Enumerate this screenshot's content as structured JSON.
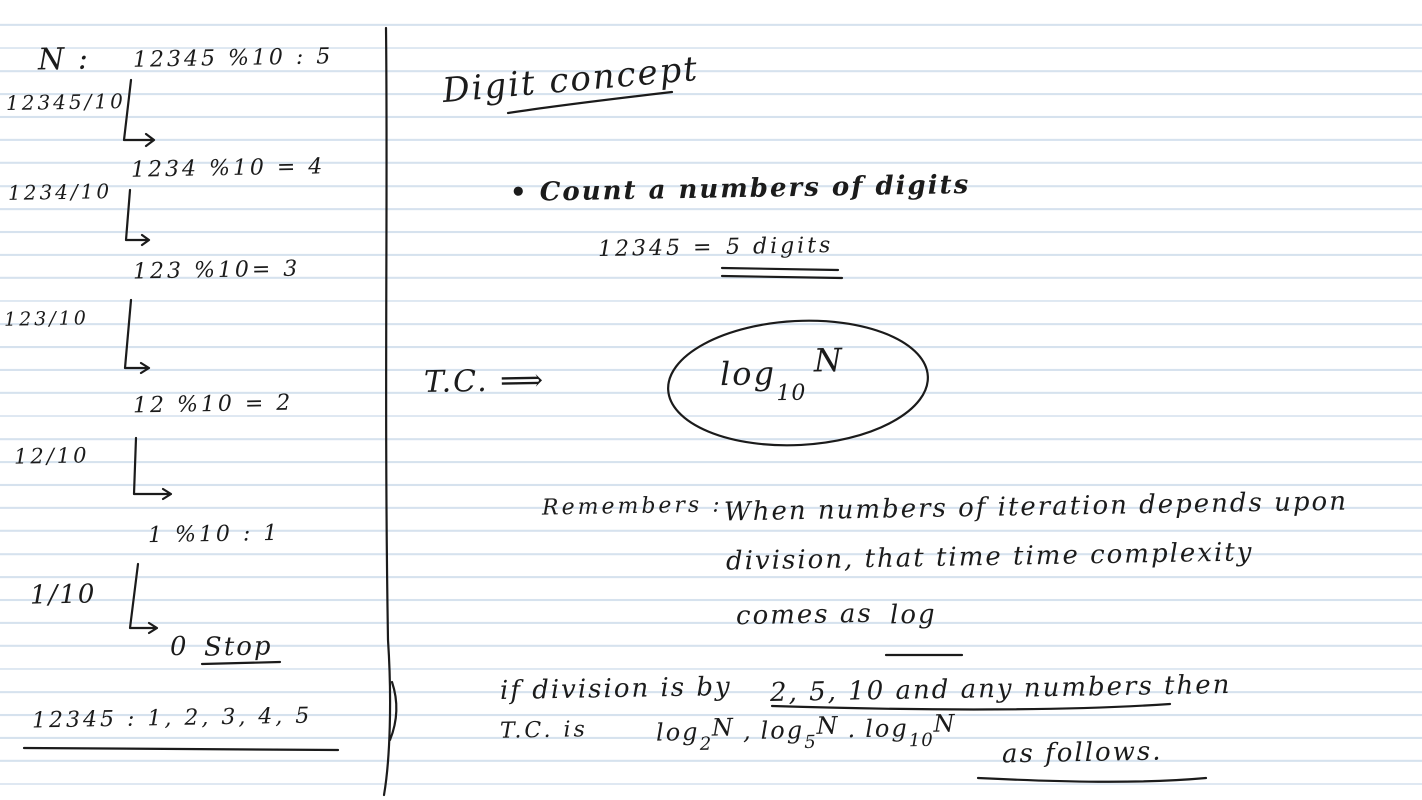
{
  "left_column": {
    "n_label": "N :",
    "steps": [
      {
        "division": "12345/10",
        "modulo": "12345 %10 : 5"
      },
      {
        "division": "1234/10",
        "modulo": "1234 %10 = 4"
      },
      {
        "division": "123/10",
        "modulo": "123 %10= 3"
      },
      {
        "division": "12/10",
        "modulo": "12 %10 = 2"
      },
      {
        "division": "1/10",
        "modulo": "1 %10 : 1"
      }
    ],
    "final_zero": "0",
    "stop_label": "Stop",
    "result": "12345 : 1, 2, 3, 4, 5"
  },
  "right_column": {
    "title": "Digit concept",
    "bullet": "• Count a numbers of digits",
    "example": "12345 =",
    "example_result": "5 digits",
    "tc_label": "T.C. ⟹",
    "tc_log": "log",
    "tc_base": "10",
    "tc_var": "N",
    "remember_label": "Remembers :",
    "remember_lines": [
      "When numbers of iteration depends upon",
      "division, that time time complexity",
      "comes as"
    ],
    "remember_log": "log",
    "note_line1_a": "if division is by",
    "note_line1_b": "2, 5, 10 and any numbers then",
    "note_line2_a": "T.C. is",
    "note_logs": [
      {
        "log": "log",
        "base": "2",
        "var": "N"
      },
      {
        "log": "log",
        "base": "5",
        "var": "N"
      },
      {
        "log": "log",
        "base": "10",
        "var": "N"
      }
    ],
    "note_line2_end": "as follows."
  }
}
